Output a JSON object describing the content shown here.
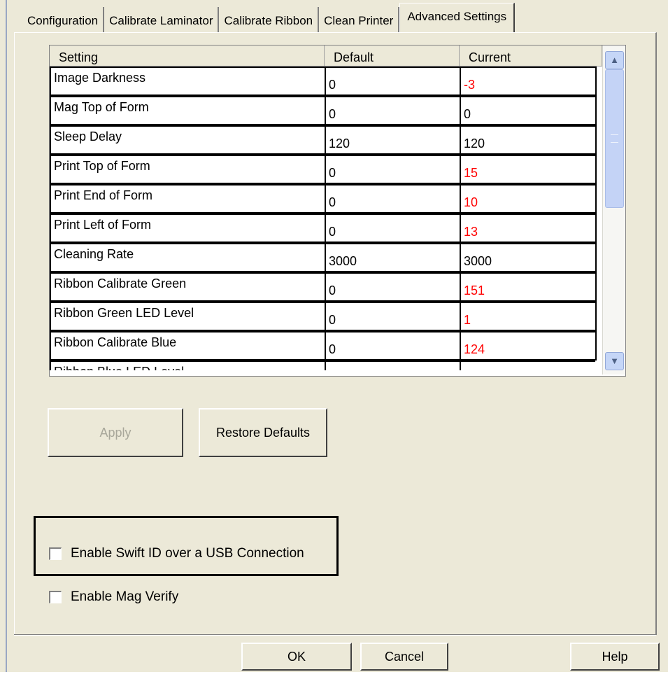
{
  "tabs": [
    {
      "label": "Configuration",
      "active": false
    },
    {
      "label": "Calibrate Laminator",
      "active": false
    },
    {
      "label": "Calibrate Ribbon",
      "active": false
    },
    {
      "label": "Clean Printer",
      "active": false
    },
    {
      "label": "Advanced Settings",
      "active": true
    }
  ],
  "grid": {
    "columns": [
      "Setting",
      "Default",
      "Current"
    ],
    "rows": [
      {
        "setting": "Image Darkness",
        "default": "0",
        "current": "-3",
        "changed": true
      },
      {
        "setting": "Mag Top of Form",
        "default": "0",
        "current": "0",
        "changed": false
      },
      {
        "setting": "Sleep Delay",
        "default": "120",
        "current": "120",
        "changed": false
      },
      {
        "setting": "Print Top of Form",
        "default": "0",
        "current": "15",
        "changed": true
      },
      {
        "setting": "Print End of Form",
        "default": "0",
        "current": "10",
        "changed": true
      },
      {
        "setting": "Print Left of Form",
        "default": "0",
        "current": "13",
        "changed": true
      },
      {
        "setting": "Cleaning Rate",
        "default": "3000",
        "current": "3000",
        "changed": false
      },
      {
        "setting": "Ribbon Calibrate Green",
        "default": "0",
        "current": "151",
        "changed": true
      },
      {
        "setting": "Ribbon Green LED Level",
        "default": "0",
        "current": "1",
        "changed": true
      },
      {
        "setting": "Ribbon Calibrate Blue",
        "default": "0",
        "current": "124",
        "changed": true
      },
      {
        "setting": "Ribbon Blue LED Level",
        "default": "",
        "current": "",
        "changed": false
      }
    ],
    "changed_color": "#ff0000"
  },
  "buttons": {
    "apply": "Apply",
    "restore_defaults": "Restore Defaults",
    "ok": "OK",
    "cancel": "Cancel",
    "help": "Help"
  },
  "options": {
    "swift_id": {
      "label": "Enable Swift ID over a USB Connection",
      "checked": false
    },
    "mag_verify": {
      "label": "Enable Mag Verify",
      "checked": false
    }
  },
  "icons": {
    "scroll_up": "scroll-up-arrow-icon",
    "scroll_down": "scroll-down-arrow-icon"
  }
}
